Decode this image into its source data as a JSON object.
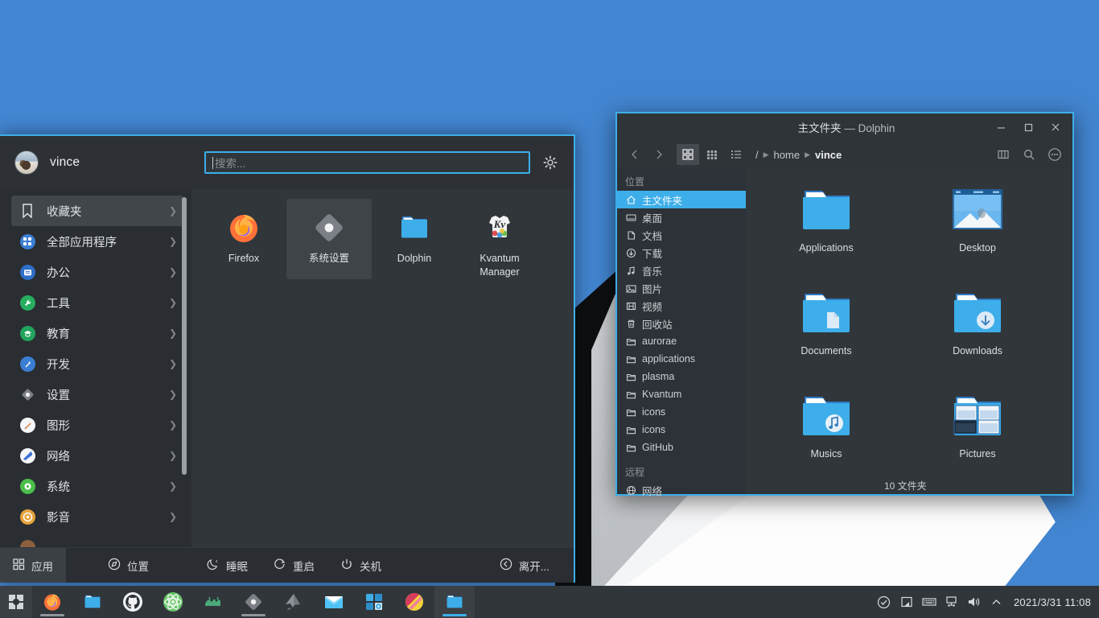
{
  "desktop": {
    "wallpaper_colors": {
      "blue": "#4285d0",
      "dark": "#0d0f11",
      "gray": "#c2c6ca",
      "white": "#fdfdfd"
    }
  },
  "accent_color": "#3daee9",
  "app_menu": {
    "user": {
      "name": "vince",
      "avatar_icon": "user-avatar-photo"
    },
    "search": {
      "value": "",
      "placeholder": "搜索...",
      "settings_icon": "gear-icon"
    },
    "categories": [
      {
        "label": "收藏夹",
        "icon": "bookmark-icon",
        "selected": true
      },
      {
        "label": "全部应用程序",
        "icon": "grid-apps-icon",
        "selected": false
      },
      {
        "label": "办公",
        "icon": "office-icon",
        "selected": false
      },
      {
        "label": "工具",
        "icon": "wrench-icon",
        "selected": false
      },
      {
        "label": "教育",
        "icon": "graduation-icon",
        "selected": false
      },
      {
        "label": "开发",
        "icon": "development-icon",
        "selected": false
      },
      {
        "label": "设置",
        "icon": "settings-diamond-icon",
        "selected": false
      },
      {
        "label": "图形",
        "icon": "graphics-brush-icon",
        "selected": false
      },
      {
        "label": "网络",
        "icon": "network-globe-icon",
        "selected": false
      },
      {
        "label": "系统",
        "icon": "system-gear-icon",
        "selected": false
      },
      {
        "label": "影音",
        "icon": "multimedia-icon",
        "selected": false
      }
    ],
    "apps": [
      {
        "label": "Firefox",
        "icon": "firefox-icon",
        "highlighted": false
      },
      {
        "label": "系统设置",
        "icon": "systemsettings-icon",
        "highlighted": true
      },
      {
        "label": "Dolphin",
        "icon": "dolphin-folder-icon",
        "highlighted": false
      },
      {
        "label": "Kvantum Manager",
        "icon": "kvantum-icon",
        "highlighted": false
      }
    ],
    "footer": [
      {
        "label": "应用",
        "icon": "apps-grid-icon",
        "active": true
      },
      {
        "label": "位置",
        "icon": "compass-icon",
        "active": false
      },
      {
        "label": "睡眠",
        "icon": "moon-sleep-icon",
        "active": false
      },
      {
        "label": "重启",
        "icon": "restart-icon",
        "active": false
      },
      {
        "label": "关机",
        "icon": "power-icon",
        "active": false
      }
    ],
    "footer_right": {
      "label": "离开...",
      "icon": "leave-icon"
    }
  },
  "dolphin": {
    "title_main": "主文件夹",
    "title_sep": " — ",
    "title_app": "Dolphin",
    "window_buttons": {
      "minimize": "minimize-icon",
      "maximize": "maximize-icon",
      "close": "close-icon"
    },
    "toolbar": {
      "back_icon": "back-arrow-icon",
      "forward_icon": "forward-arrow-icon",
      "view_icons_icon": "view-icons-icon",
      "view_compact_icon": "view-compact-icon",
      "view_details_icon": "view-details-icon",
      "split_icon": "split-view-icon",
      "search_icon": "search-icon",
      "menu_icon": "hamburger-more-icon"
    },
    "breadcrumb": {
      "root": "/",
      "segments": [
        "home",
        "vince"
      ]
    },
    "places_header": "位置",
    "places": [
      {
        "label": "主文件夹",
        "icon": "home-icon",
        "selected": true
      },
      {
        "label": "桌面",
        "icon": "desktop-icon",
        "selected": false
      },
      {
        "label": "文档",
        "icon": "documents-icon",
        "selected": false
      },
      {
        "label": "下载",
        "icon": "download-icon",
        "selected": false
      },
      {
        "label": "音乐",
        "icon": "music-note-icon",
        "selected": false
      },
      {
        "label": "图片",
        "icon": "picture-icon",
        "selected": false
      },
      {
        "label": "视频",
        "icon": "video-icon",
        "selected": false
      },
      {
        "label": "回收站",
        "icon": "trash-icon",
        "selected": false
      },
      {
        "label": "aurorae",
        "icon": "folder-icon",
        "selected": false
      },
      {
        "label": "applications",
        "icon": "folder-icon",
        "selected": false
      },
      {
        "label": "plasma",
        "icon": "folder-icon",
        "selected": false
      },
      {
        "label": "Kvantum",
        "icon": "folder-icon",
        "selected": false
      },
      {
        "label": "icons",
        "icon": "folder-icon",
        "selected": false
      },
      {
        "label": "icons",
        "icon": "folder-icon",
        "selected": false
      },
      {
        "label": "GitHub",
        "icon": "folder-icon",
        "selected": false
      }
    ],
    "remote_header": "远程",
    "remote": [
      {
        "label": "网络",
        "icon": "network-icon"
      }
    ],
    "files": [
      {
        "label": "Applications",
        "icon": "folder-plain-icon"
      },
      {
        "label": "Desktop",
        "icon": "folder-desktop-icon"
      },
      {
        "label": "Documents",
        "icon": "folder-documents-icon"
      },
      {
        "label": "Downloads",
        "icon": "folder-downloads-icon"
      },
      {
        "label": "Musics",
        "icon": "folder-music-icon"
      },
      {
        "label": "Pictures",
        "icon": "folder-pictures-icon"
      }
    ],
    "status_text": "10 文件夹"
  },
  "taskbar": {
    "launcher_icon": "kickoff-launcher-icon",
    "tasks": [
      {
        "icon": "firefox-icon",
        "running": true,
        "active": false
      },
      {
        "icon": "dolphin-folder-icon",
        "running": false,
        "active": false
      },
      {
        "icon": "github-icon",
        "running": false,
        "active": false
      },
      {
        "icon": "atom-icon",
        "running": false,
        "active": false
      },
      {
        "icon": "nautilus-icon",
        "running": false,
        "active": false
      },
      {
        "icon": "systemsettings-icon",
        "running": true,
        "active": false
      },
      {
        "icon": "inkscape-icon",
        "running": false,
        "active": false
      },
      {
        "icon": "mail-icon",
        "running": false,
        "active": false
      },
      {
        "icon": "discover-icon",
        "running": false,
        "active": false
      },
      {
        "icon": "krita-icon",
        "running": false,
        "active": false
      },
      {
        "icon": "dolphin-folder-icon",
        "running": true,
        "active": true
      }
    ],
    "tray": [
      {
        "icon": "status-check-icon"
      },
      {
        "icon": "clipboard-icon"
      },
      {
        "icon": "keyboard-icon"
      },
      {
        "icon": "network-wired-icon"
      },
      {
        "icon": "volume-icon"
      },
      {
        "icon": "chevron-up-icon"
      }
    ],
    "clock": "2021/3/31 11:08"
  }
}
